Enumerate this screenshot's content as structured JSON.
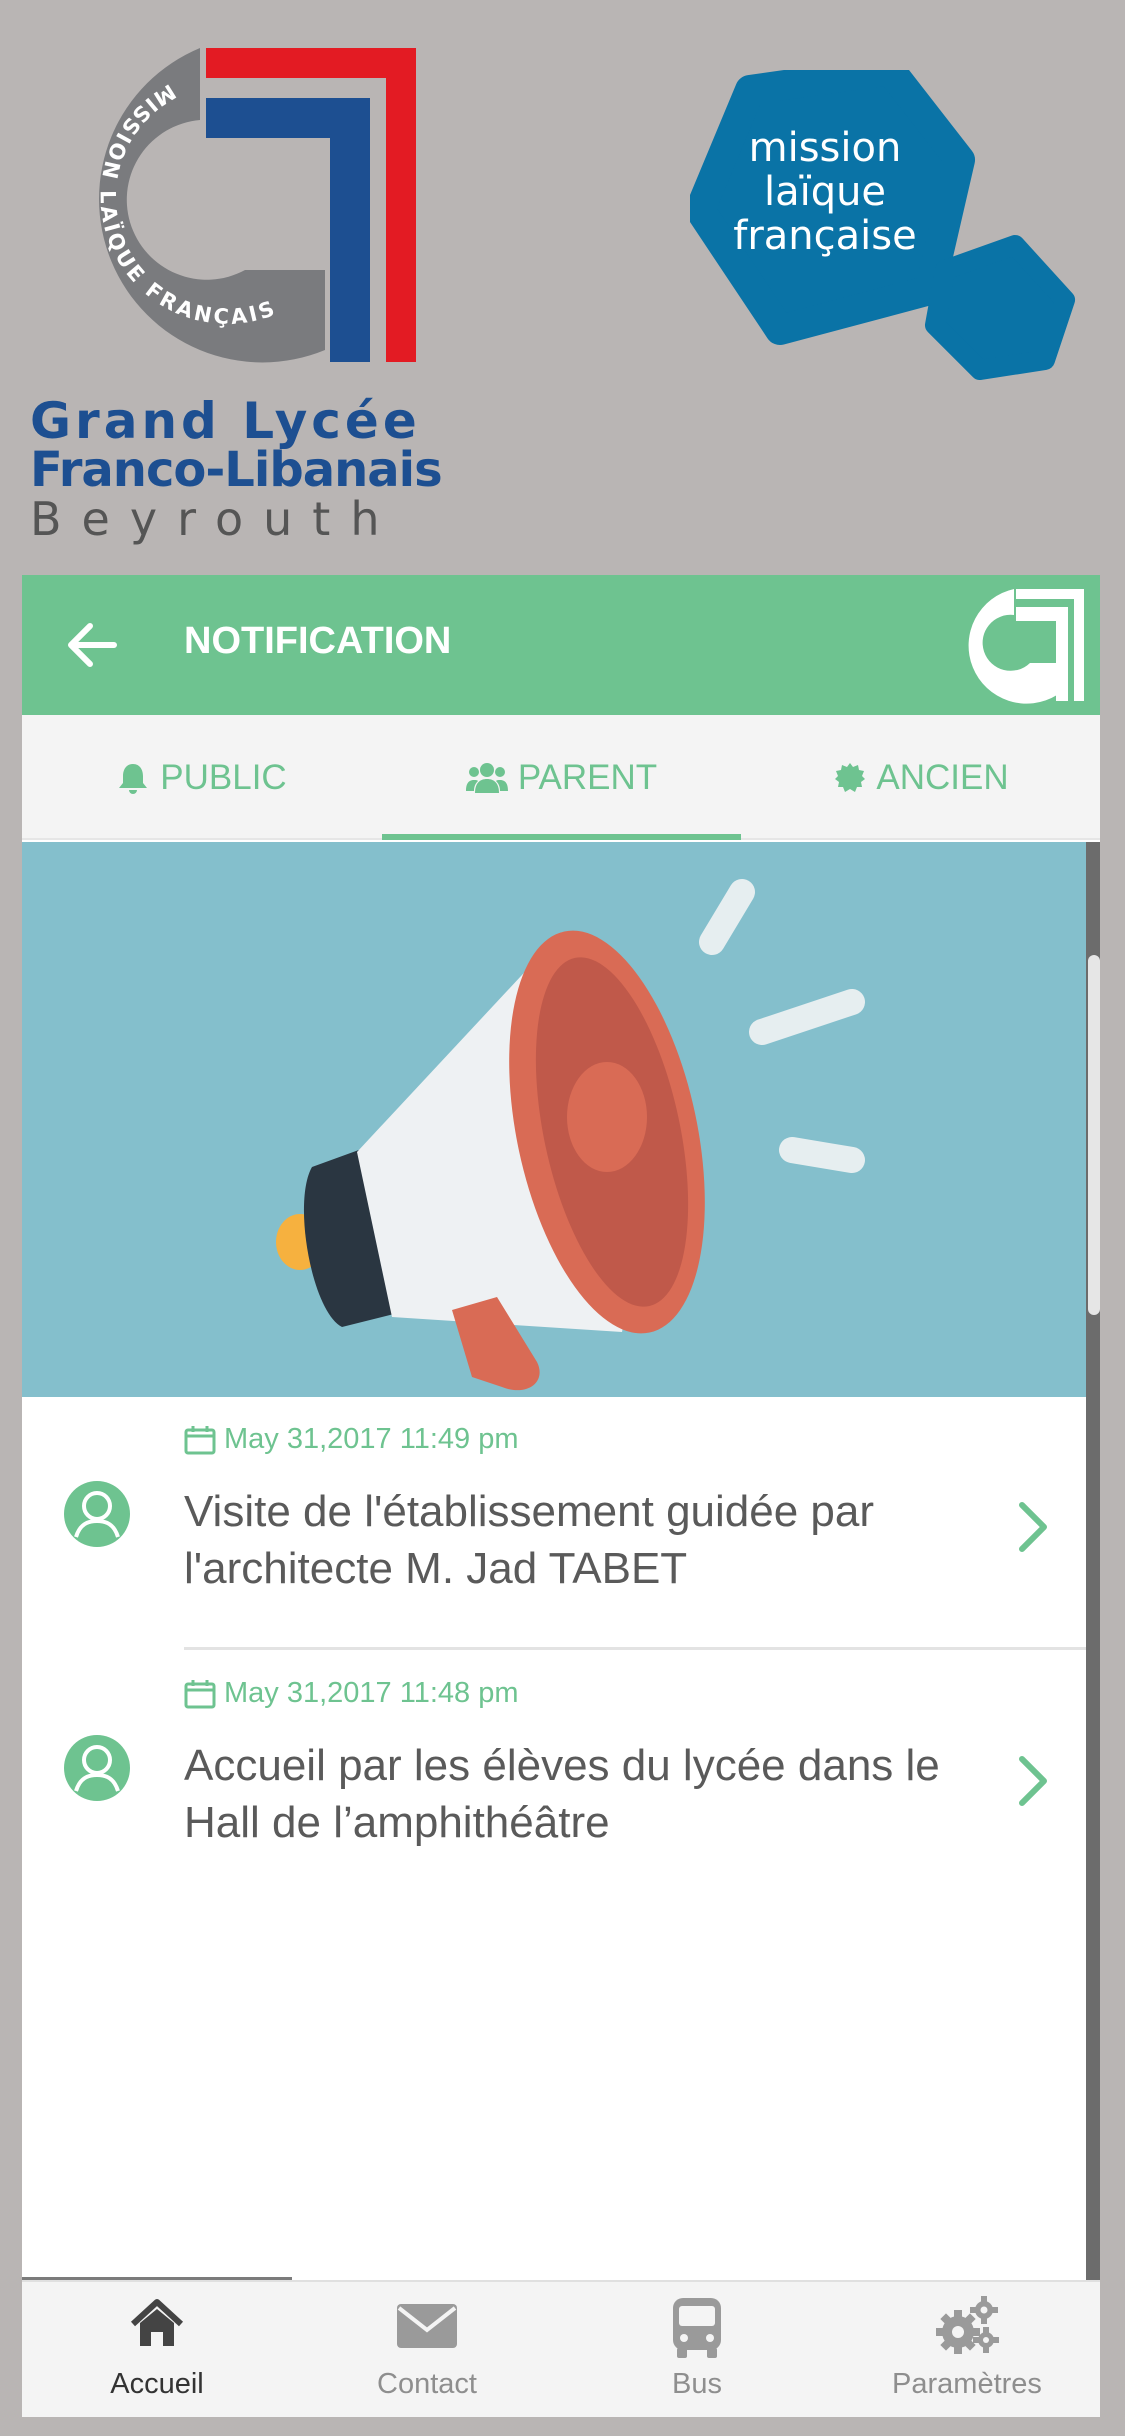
{
  "header": {
    "school_logo_lines": [
      "Grand Lycée",
      "Franco-Libanais",
      "Beyrouth"
    ],
    "school_logo_ring_text": "MISSION LAÏQUE FRANÇAISE",
    "mlf_logo_lines": [
      "mission",
      "laïque",
      "française"
    ]
  },
  "app_bar": {
    "title": "NOTIFICATION",
    "back_icon": "arrow-left-icon",
    "logo_icon": "school-logo-icon"
  },
  "tabs": [
    {
      "label": "PUBLIC",
      "icon": "bell-icon",
      "selected": false
    },
    {
      "label": "PARENT",
      "icon": "users-icon",
      "selected": true
    },
    {
      "label": "ANCIEN",
      "icon": "gear-badge-icon",
      "selected": false
    }
  ],
  "banner": {
    "icon": "megaphone-icon"
  },
  "notifications": [
    {
      "date": "May 31,2017 11:49 pm",
      "title": "Visite de l'établissement guidée par l'architecte M. Jad TABET"
    },
    {
      "date": "May 31,2017 11:48 pm",
      "title": "Accueil par les élèves du lycée dans le Hall de l’amphithéâtre"
    }
  ],
  "bottom_nav": [
    {
      "label": "Accueil",
      "icon": "home-icon",
      "active": true
    },
    {
      "label": "Contact",
      "icon": "envelope-icon",
      "active": false
    },
    {
      "label": "Bus",
      "icon": "bus-icon",
      "active": false
    },
    {
      "label": "Paramètres",
      "icon": "gears-icon",
      "active": false
    }
  ],
  "colors": {
    "accent": "#6ec390",
    "background": "#b9b5b4",
    "text_dark": "#5a5a5a",
    "banner": "#84bfcc",
    "logo_blue": "#1d4f91",
    "logo_red": "#e31b23",
    "mlf_blue": "#0a73a6"
  }
}
